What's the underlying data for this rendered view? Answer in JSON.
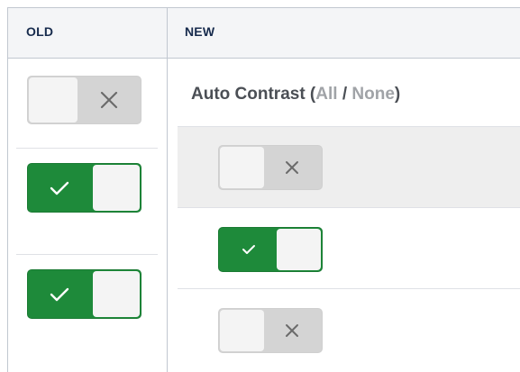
{
  "columns": {
    "old_label": "OLD",
    "new_label": "NEW"
  },
  "new_section": {
    "title_text": "Auto Contrast",
    "open_paren": " (",
    "all_label": "All",
    "separator": " / ",
    "none_label": "None",
    "close_paren": ")"
  },
  "old_toggles": [
    {
      "state": "off",
      "glyph": "x-icon"
    },
    {
      "state": "on",
      "glyph": "check-icon"
    },
    {
      "state": "on",
      "glyph": "check-icon"
    }
  ],
  "new_toggles": [
    {
      "state": "off",
      "glyph": "x-icon",
      "hovered": true
    },
    {
      "state": "on",
      "glyph": "check-icon"
    },
    {
      "state": "off",
      "glyph": "x-icon"
    }
  ],
  "colors": {
    "on_green": "#1e8a3a",
    "off_gray": "#d4d4d4",
    "knob": "#f4f4f4",
    "header_bg": "#f4f5f7",
    "hover_bg": "#eeeeee"
  }
}
